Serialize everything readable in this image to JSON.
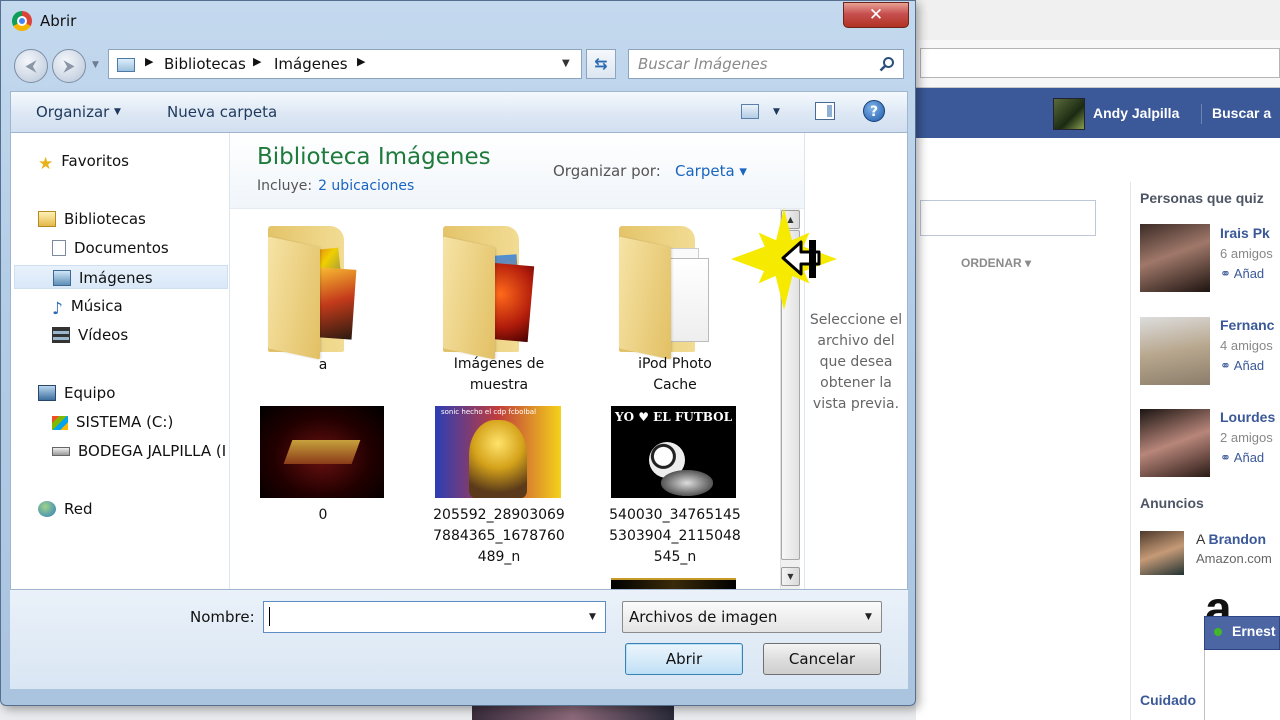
{
  "background": {
    "facebook": {
      "user_name": "Andy Jalpilla",
      "search_link": "Buscar a",
      "ordenar_label": "ORDENAR ▾",
      "people_title": "Personas que quiz",
      "friends": [
        {
          "name": "Irais Pk",
          "mutual": "6 amigos",
          "add": "Añad"
        },
        {
          "name": "Fernanc",
          "mutual": "4 amigos",
          "add": "Añad"
        },
        {
          "name": "Lourdes",
          "mutual": "2 amigos",
          "add": "Añad"
        }
      ],
      "ads_title": "Anuncios",
      "ad_name_prefix": "A",
      "ad_name": "Brandon",
      "ad_site": "Amazon.com",
      "ad_logo": "a",
      "chat_name": "Ernest",
      "bottom_link": "Cuidado"
    }
  },
  "dialog": {
    "title": "Abrir",
    "close_label": "✕",
    "breadcrumb": [
      "Bibliotecas",
      "Imágenes"
    ],
    "search_placeholder": "Buscar Imágenes",
    "toolbar": {
      "organize": "Organizar",
      "new_folder": "Nueva carpeta"
    },
    "nav": {
      "favorites": "Favoritos",
      "libraries": "Bibliotecas",
      "documents": "Documentos",
      "pictures": "Imágenes",
      "music": "Música",
      "videos": "Vídeos",
      "computer": "Equipo",
      "drive_c": "SISTEMA  (C:)",
      "drive_d": "BODEGA JALPILLA (I",
      "network": "Red"
    },
    "library": {
      "title": "Biblioteca Imágenes",
      "includes_label": "Incluye:",
      "includes_link": "2 ubicaciones",
      "arrange_label": "Organizar por:",
      "arrange_value": "Carpeta ▾"
    },
    "items": [
      {
        "label": "a",
        "kind": "folder"
      },
      {
        "label": "Imágenes de muestra",
        "kind": "folder"
      },
      {
        "label": "iPod Photo Cache",
        "kind": "folder"
      },
      {
        "label": "0",
        "kind": "image"
      },
      {
        "label": "205592_289030697884365_1678760489_n",
        "kind": "image"
      },
      {
        "label": "540030_347651455303904_2115048545_n",
        "kind": "image"
      }
    ],
    "item_label_lines": {
      "f2": [
        "Imágenes de",
        "muestra"
      ],
      "f3": [
        "iPod Photo",
        "Cache"
      ],
      "i5": [
        "205592_28903069",
        "7884365_1678760",
        "489_n"
      ],
      "i6": [
        "540030_34765145",
        "5303904_2115048",
        "545_n"
      ]
    },
    "preview_text": "Seleccione el archivo del que desea obtener la vista previa.",
    "thumb_texts": {
      "dbz_caption": "sonic hecho el cdp fcbolbal",
      "futbol_caption": "YO ♥ EL FUTBOL"
    },
    "filename_label": "Nombre:",
    "filename_value": "",
    "filetype": "Archivos de imagen",
    "open_button": "Abrir",
    "cancel_button": "Cancelar"
  }
}
